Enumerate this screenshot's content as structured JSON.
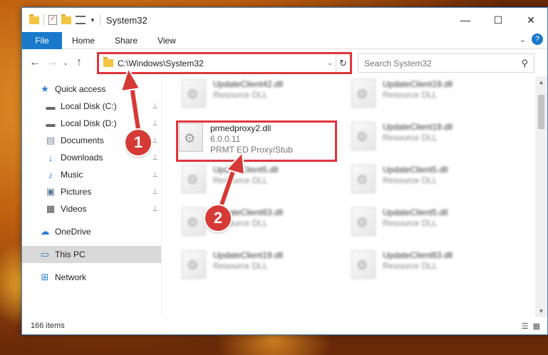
{
  "window": {
    "title": "System32",
    "controls": {
      "minimize": "—",
      "maximize": "☐",
      "close": "✕"
    }
  },
  "ribbon": {
    "file_label": "File",
    "tabs": [
      "Home",
      "Share",
      "View"
    ],
    "expand_glyph": "⌄",
    "help_glyph": "?"
  },
  "nav": {
    "back": "←",
    "forward": "→",
    "recent": "⌄",
    "up": "↑",
    "address": "C:\\Windows\\System32",
    "address_dropdown": "⌄",
    "refresh": "↻",
    "search_placeholder": "Search System32",
    "search_icon": "⚲"
  },
  "sidebar": {
    "items": [
      {
        "label": "Quick access",
        "icon": "★",
        "icon_name": "star-icon",
        "pinned": false
      },
      {
        "label": "Local Disk (C:)",
        "icon": "▬",
        "icon_name": "drive-icon",
        "pinned": true
      },
      {
        "label": "Local Disk (D:)",
        "icon": "▬",
        "icon_name": "drive-icon",
        "pinned": true
      },
      {
        "label": "Documents",
        "icon": "▤",
        "icon_name": "documents-icon",
        "pinned": true
      },
      {
        "label": "Downloads",
        "icon": "↓",
        "icon_name": "downloads-icon",
        "pinned": true
      },
      {
        "label": "Music",
        "icon": "♪",
        "icon_name": "music-icon",
        "pinned": true
      },
      {
        "label": "Pictures",
        "icon": "▣",
        "icon_name": "pictures-icon",
        "pinned": true
      },
      {
        "label": "Videos",
        "icon": "▦",
        "icon_name": "videos-icon",
        "pinned": true
      },
      {
        "label": "OneDrive",
        "icon": "☁",
        "icon_name": "onedrive-icon",
        "pinned": false
      },
      {
        "label": "This PC",
        "icon": "▭",
        "icon_name": "computer-icon",
        "pinned": false
      },
      {
        "label": "Network",
        "icon": "⊞",
        "icon_name": "network-icon",
        "pinned": false
      }
    ],
    "pin_glyph": "📌"
  },
  "files": {
    "highlighted": {
      "name": "prmedproxy2.dll",
      "version": "6.0.0.11",
      "description": "PRMT ED Proxy/Stub"
    },
    "items": [
      {
        "name": "UpdateClient42.dll",
        "type": "Resource DLL"
      },
      {
        "name": "UpdateClient19.dll",
        "type": "Resource DLL"
      },
      {
        "name": "UpdateClient19.dll",
        "type": "Resource DLL"
      },
      {
        "name": "UpdateClient5.dll",
        "type": "Resource DLL"
      },
      {
        "name": "UpdateClient5.dll",
        "type": "Resource DLL"
      },
      {
        "name": "UpdateClient63.dll",
        "type": "Resource DLL"
      },
      {
        "name": "UpdateClient5.dll",
        "type": "Resource DLL"
      },
      {
        "name": "UpdateClient19.dll",
        "type": "Resource DLL"
      },
      {
        "name": "UpdateClient63.dll",
        "type": "Resource DLL"
      }
    ]
  },
  "status": {
    "count": "166 items",
    "details_view": "☰",
    "icons_view": "▦"
  },
  "callouts": {
    "one": "1",
    "two": "2"
  },
  "colors": {
    "accent": "#1979ca",
    "highlight": "#e0353b",
    "callout": "#d63a36"
  }
}
